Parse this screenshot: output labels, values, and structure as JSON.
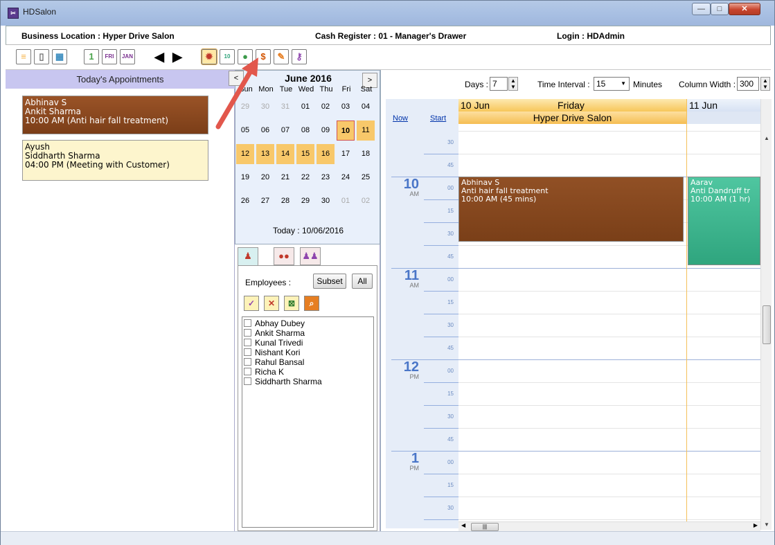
{
  "window": {
    "title": "HDSalon",
    "icon": "scissors-app-icon",
    "min_symbol": "—",
    "max_symbol": "□",
    "close_symbol": "✕"
  },
  "info": {
    "business_location": "Business Location : Hyper Drive Salon",
    "cash_register": "Cash Register : 01 - Manager's Drawer",
    "login": "Login : HDAdmin"
  },
  "toolbar": {
    "buttons": [
      {
        "name": "menu-list-icon",
        "glyph": "≡",
        "color": "#f6b44a"
      },
      {
        "name": "mobile-device-icon",
        "glyph": "▯",
        "color": "#6e6e6e"
      },
      {
        "name": "month-calendar-icon",
        "glyph": "▦",
        "color": "#3c8dbf"
      },
      {
        "name": "day-calendar-icon",
        "glyph": "1",
        "color": "#49a34a"
      },
      {
        "name": "friday-calendar-icon",
        "glyph": "FRI",
        "color": "#7a2f8f"
      },
      {
        "name": "january-calendar-icon",
        "glyph": "JAN",
        "color": "#7a2f8f"
      },
      {
        "name": "previous-arrow-icon",
        "glyph": "◀"
      },
      {
        "name": "next-arrow-icon",
        "glyph": "▶"
      },
      {
        "name": "settings-gear-icon",
        "glyph": "✹",
        "color": "#c0392b"
      },
      {
        "name": "date-ten-icon",
        "glyph": "10",
        "color": "#2ea37a"
      },
      {
        "name": "customer-person-icon",
        "glyph": "●",
        "color": "#3c9a4a"
      },
      {
        "name": "sale-transfer-icon",
        "glyph": "$",
        "color": "#d35400"
      },
      {
        "name": "notes-edit-icon",
        "glyph": "✎",
        "color": "#e67e22"
      },
      {
        "name": "key-icon",
        "glyph": "⚷",
        "color": "#8e44ad"
      }
    ]
  },
  "today": {
    "header": "Today's Appointments",
    "appointments": [
      {
        "customer": "Abhinav S",
        "employee": "Ankit Sharma",
        "time": "10:00 AM (Anti hair fall treatment)"
      },
      {
        "customer": "Ayush",
        "employee": "Siddharth Sharma",
        "time": "04:00 PM (Meeting with Customer)"
      }
    ]
  },
  "calendar": {
    "month": "June 2016",
    "prev": "<",
    "next": ">",
    "weekdays": [
      "Sun",
      "Mon",
      "Tue",
      "Wed",
      "Thu",
      "Fri",
      "Sat"
    ],
    "weeks": [
      [
        [
          "29",
          "gray"
        ],
        [
          "30",
          "gray"
        ],
        [
          "31",
          "gray"
        ],
        [
          "01",
          ""
        ],
        [
          "02",
          ""
        ],
        [
          "03",
          ""
        ],
        [
          "04",
          ""
        ]
      ],
      [
        [
          "05",
          ""
        ],
        [
          "06",
          ""
        ],
        [
          "07",
          ""
        ],
        [
          "08",
          ""
        ],
        [
          "09",
          ""
        ],
        [
          "10",
          "today"
        ],
        [
          "11",
          "hi"
        ]
      ],
      [
        [
          "12",
          "hi"
        ],
        [
          "13",
          "hi"
        ],
        [
          "14",
          "hi"
        ],
        [
          "15",
          "hi"
        ],
        [
          "16",
          "hi"
        ],
        [
          "17",
          ""
        ],
        [
          "18",
          ""
        ]
      ],
      [
        [
          "19",
          ""
        ],
        [
          "20",
          ""
        ],
        [
          "21",
          ""
        ],
        [
          "22",
          ""
        ],
        [
          "23",
          ""
        ],
        [
          "24",
          ""
        ],
        [
          "25",
          ""
        ]
      ],
      [
        [
          "26",
          ""
        ],
        [
          "27",
          ""
        ],
        [
          "28",
          ""
        ],
        [
          "29",
          ""
        ],
        [
          "30",
          ""
        ],
        [
          "01",
          "gray"
        ],
        [
          "02",
          "gray"
        ]
      ]
    ],
    "today_text": "Today : 10/06/2016"
  },
  "employees": {
    "label": "Employees :",
    "subset_label": "Subset",
    "all_label": "All",
    "list": [
      "Abhay Dubey",
      "Ankit Sharma",
      "Kunal Trivedi",
      "Nishant Kori",
      "Rahul Bansal",
      "Richa K",
      "Siddharth Sharma"
    ]
  },
  "schedule": {
    "days_label": "Days :",
    "days_value": "7",
    "interval_label": "Time Interval :",
    "interval_value": "15",
    "minutes_label": "Minutes",
    "colwidth_label": "Column Width :",
    "colwidth_value": "300",
    "now_label": "Now",
    "start_label": "Start",
    "day1_date": "10 Jun",
    "day1_name": "Friday",
    "day2_date": "11 Jun",
    "location": "Hyper Drive Salon",
    "hours": [
      {
        "hour": "10",
        "ampm": "AM"
      },
      {
        "hour": "11",
        "ampm": "AM"
      },
      {
        "hour": "12",
        "ampm": "PM"
      },
      {
        "hour": "1",
        "ampm": "PM"
      }
    ],
    "minute_marks": [
      "00",
      "15",
      "30",
      "45"
    ],
    "events": [
      {
        "customer": "Abhinav S",
        "service": "Anti hair fall treatment",
        "time": "10:00 AM (45 mins)"
      },
      {
        "customer": "Aarav",
        "service": "Anti Dandruff tr",
        "time": "10:00 AM (1 hr)"
      }
    ]
  }
}
